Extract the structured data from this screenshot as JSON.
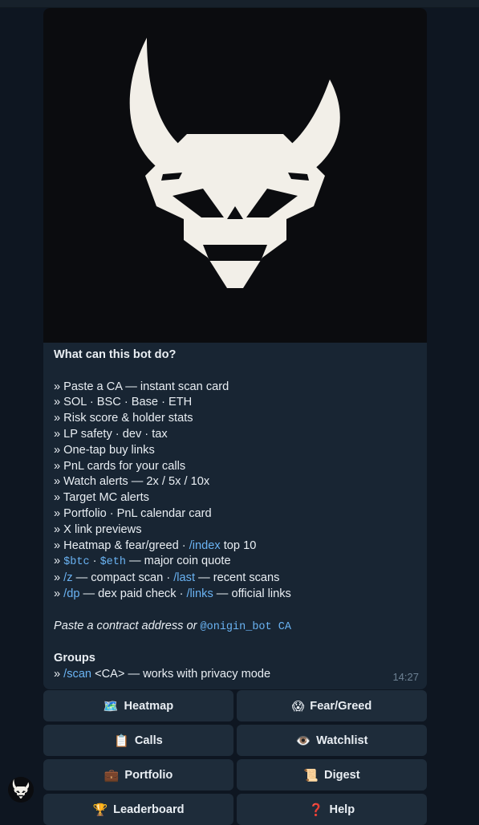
{
  "message": {
    "title": "What can this bot do?",
    "lines": [
      "» Paste a CA — instant scan card",
      "» SOL · BSC · Base · ETH",
      "» Risk score & holder stats",
      "» LP safety · dev · tax",
      "» One-tap buy links",
      "» PnL cards for your calls",
      "» Watch alerts — 2x / 5x / 10x",
      "» Target MC alerts",
      "» Portfolio · PnL calendar card",
      "» X link previews"
    ],
    "heatmap_line": {
      "prefix": "» Heatmap & fear/greed · ",
      "cmd": "/index",
      "suffix": " top 10"
    },
    "quote_line": {
      "prefix": "» ",
      "btc": "$btc",
      "sep": " · ",
      "eth": "$eth",
      "suffix": " — major coin quote"
    },
    "scan_line": {
      "prefix": "» ",
      "z": "/z",
      "mid": " — compact scan · ",
      "last": "/last",
      "suffix": " — recent scans"
    },
    "dp_line": {
      "prefix": "» ",
      "dp": "/dp",
      "mid": " — dex paid check · ",
      "links": "/links",
      "suffix": " — official links"
    },
    "paste_line": {
      "text": "Paste a contract address or ",
      "mention": "@onigin_bot CA"
    },
    "groups_title": "Groups",
    "groups_line": {
      "prefix": "» ",
      "cmd": "/scan",
      "suffix": " <CA> — works with privacy mode"
    },
    "time": "14:27"
  },
  "keyboard": [
    {
      "icon": "🗺️",
      "label": "Heatmap"
    },
    {
      "icon": "😱",
      "label": "Fear/Greed"
    },
    {
      "icon": "📋",
      "label": "Calls"
    },
    {
      "icon": "👁️",
      "label": "Watchlist"
    },
    {
      "icon": "💼",
      "label": "Portfolio"
    },
    {
      "icon": "📜",
      "label": "Digest"
    },
    {
      "icon": "🏆",
      "label": "Leaderboard"
    },
    {
      "icon": "❓",
      "label": "Help"
    }
  ]
}
